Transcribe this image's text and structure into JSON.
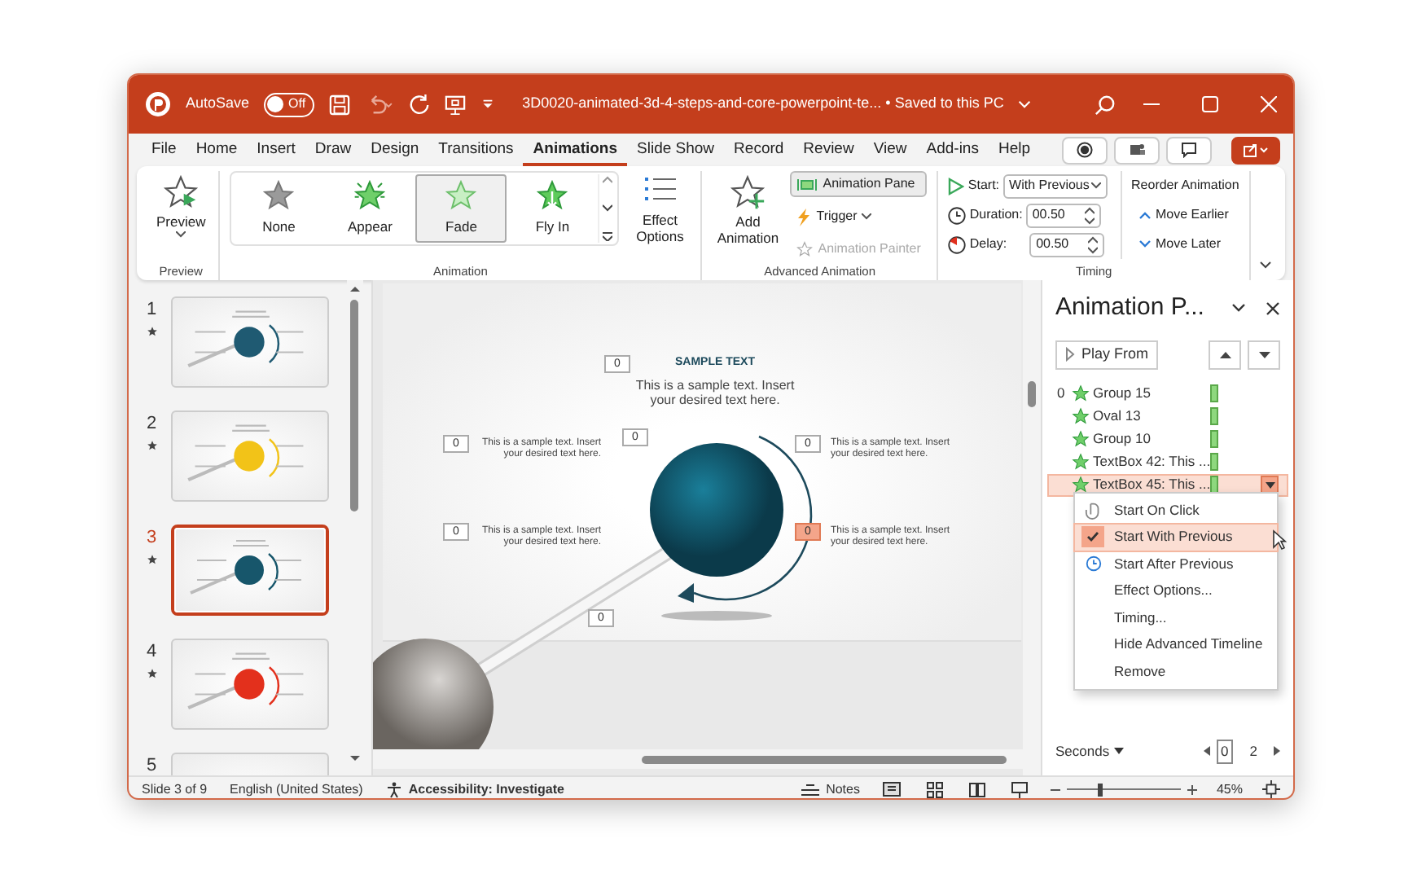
{
  "title_bar": {
    "autosave_label": "AutoSave",
    "autosave": {
      "on": false,
      "state": "Off"
    },
    "file_title": "3D0020-animated-3d-4-steps-and-core-powerpoint-te...",
    "save_status": "• Saved to this PC"
  },
  "tabs": [
    {
      "label": "File",
      "selected": false
    },
    {
      "label": "Home",
      "selected": false
    },
    {
      "label": "Insert",
      "selected": false
    },
    {
      "label": "Draw",
      "selected": false
    },
    {
      "label": "Design",
      "selected": false
    },
    {
      "label": "Transitions",
      "selected": false
    },
    {
      "label": "Animations",
      "selected": true
    },
    {
      "label": "Slide Show",
      "selected": false
    },
    {
      "label": "Record",
      "selected": false
    },
    {
      "label": "Review",
      "selected": false
    },
    {
      "label": "View",
      "selected": false
    },
    {
      "label": "Add-ins",
      "selected": false
    },
    {
      "label": "Help",
      "selected": false
    }
  ],
  "ribbon": {
    "preview": {
      "button": "Preview",
      "group_label": "Preview"
    },
    "animation": {
      "gallery": [
        {
          "label": "None",
          "kind": "none",
          "selected": false
        },
        {
          "label": "Appear",
          "kind": "appear",
          "selected": false
        },
        {
          "label": "Fade",
          "kind": "fade",
          "selected": true
        },
        {
          "label": "Fly In",
          "kind": "fly",
          "selected": false
        }
      ],
      "effect_options": "Effect Options",
      "group_label": "Animation"
    },
    "advanced": {
      "add_animation": "Add Animation",
      "animation_pane": {
        "label": "Animation Pane",
        "on": true
      },
      "trigger": "Trigger",
      "animation_painter": {
        "label": "Animation Painter",
        "disabled": true
      },
      "group_label": "Advanced Animation"
    },
    "timing": {
      "start_label": "Start:",
      "start_value": "With Previous",
      "duration_label": "Duration:",
      "duration_value": "00.50",
      "delay_label": "Delay:",
      "delay_value": "00.50",
      "reorder_title": "Reorder Animation",
      "move_earlier": "Move Earlier",
      "move_later": "Move Later",
      "group_label": "Timing"
    }
  },
  "slides": [
    {
      "number": "1",
      "selected": false,
      "color": "#1f5a72"
    },
    {
      "number": "2",
      "selected": false,
      "color": "#f2c318"
    },
    {
      "number": "3",
      "selected": true,
      "color": "#17566b"
    },
    {
      "number": "4",
      "selected": false,
      "color": "#e3301c"
    },
    {
      "number": "5",
      "selected": false
    }
  ],
  "slide": {
    "heading": "SAMPLE TEXT",
    "intro": "This is a sample text. Insert your desired text here.",
    "side_texts": [
      "This is a sample text. Insert your desired text here.",
      "This is a sample text. Insert your desired text here.",
      "This is a sample text. Insert your desired text here.",
      "This is a sample text. Insert your desired text here."
    ],
    "animation_tags": [
      {
        "label": "0",
        "selected": false
      },
      {
        "label": "0",
        "selected": false
      },
      {
        "label": "0",
        "selected": false
      },
      {
        "label": "0",
        "selected": false
      },
      {
        "label": "0",
        "selected": false
      },
      {
        "label": "0",
        "selected": true
      },
      {
        "label": "0",
        "selected": false
      }
    ]
  },
  "animation_pane": {
    "title": "Animation P...",
    "play_from": "Play From",
    "items": [
      {
        "order": "0",
        "label": "Group 15",
        "selected": false
      },
      {
        "label": "Oval 13",
        "selected": false
      },
      {
        "label": "Group 10",
        "selected": false
      },
      {
        "label": "TextBox 42: This ...",
        "selected": false
      },
      {
        "label": "TextBox 45: This ...",
        "selected": true
      }
    ],
    "menu": [
      {
        "label": "Start On Click",
        "kind": "click",
        "checked": false,
        "selected": false
      },
      {
        "label": "Start With Previous",
        "kind": "with",
        "checked": true,
        "selected": true
      },
      {
        "label": "Start After Previous",
        "kind": "after",
        "checked": false,
        "selected": false
      },
      {
        "label": "Effect Options...",
        "kind": "plain",
        "checked": false,
        "selected": false
      },
      {
        "label": "Timing...",
        "kind": "plain",
        "checked": false,
        "selected": false
      },
      {
        "label": "Hide Advanced Timeline",
        "kind": "plain",
        "checked": false,
        "selected": false
      },
      {
        "label": "Remove",
        "kind": "plain",
        "checked": false,
        "selected": false
      }
    ],
    "seconds": "Seconds",
    "timeline_start": "0",
    "timeline_end": "2"
  },
  "status_bar": {
    "slide_count": "Slide 3 of 9",
    "language": "English (United States)",
    "accessibility": "Accessibility: Investigate",
    "notes": "Notes",
    "zoom": {
      "level": 0.3
    },
    "zoom_value": "45%"
  }
}
